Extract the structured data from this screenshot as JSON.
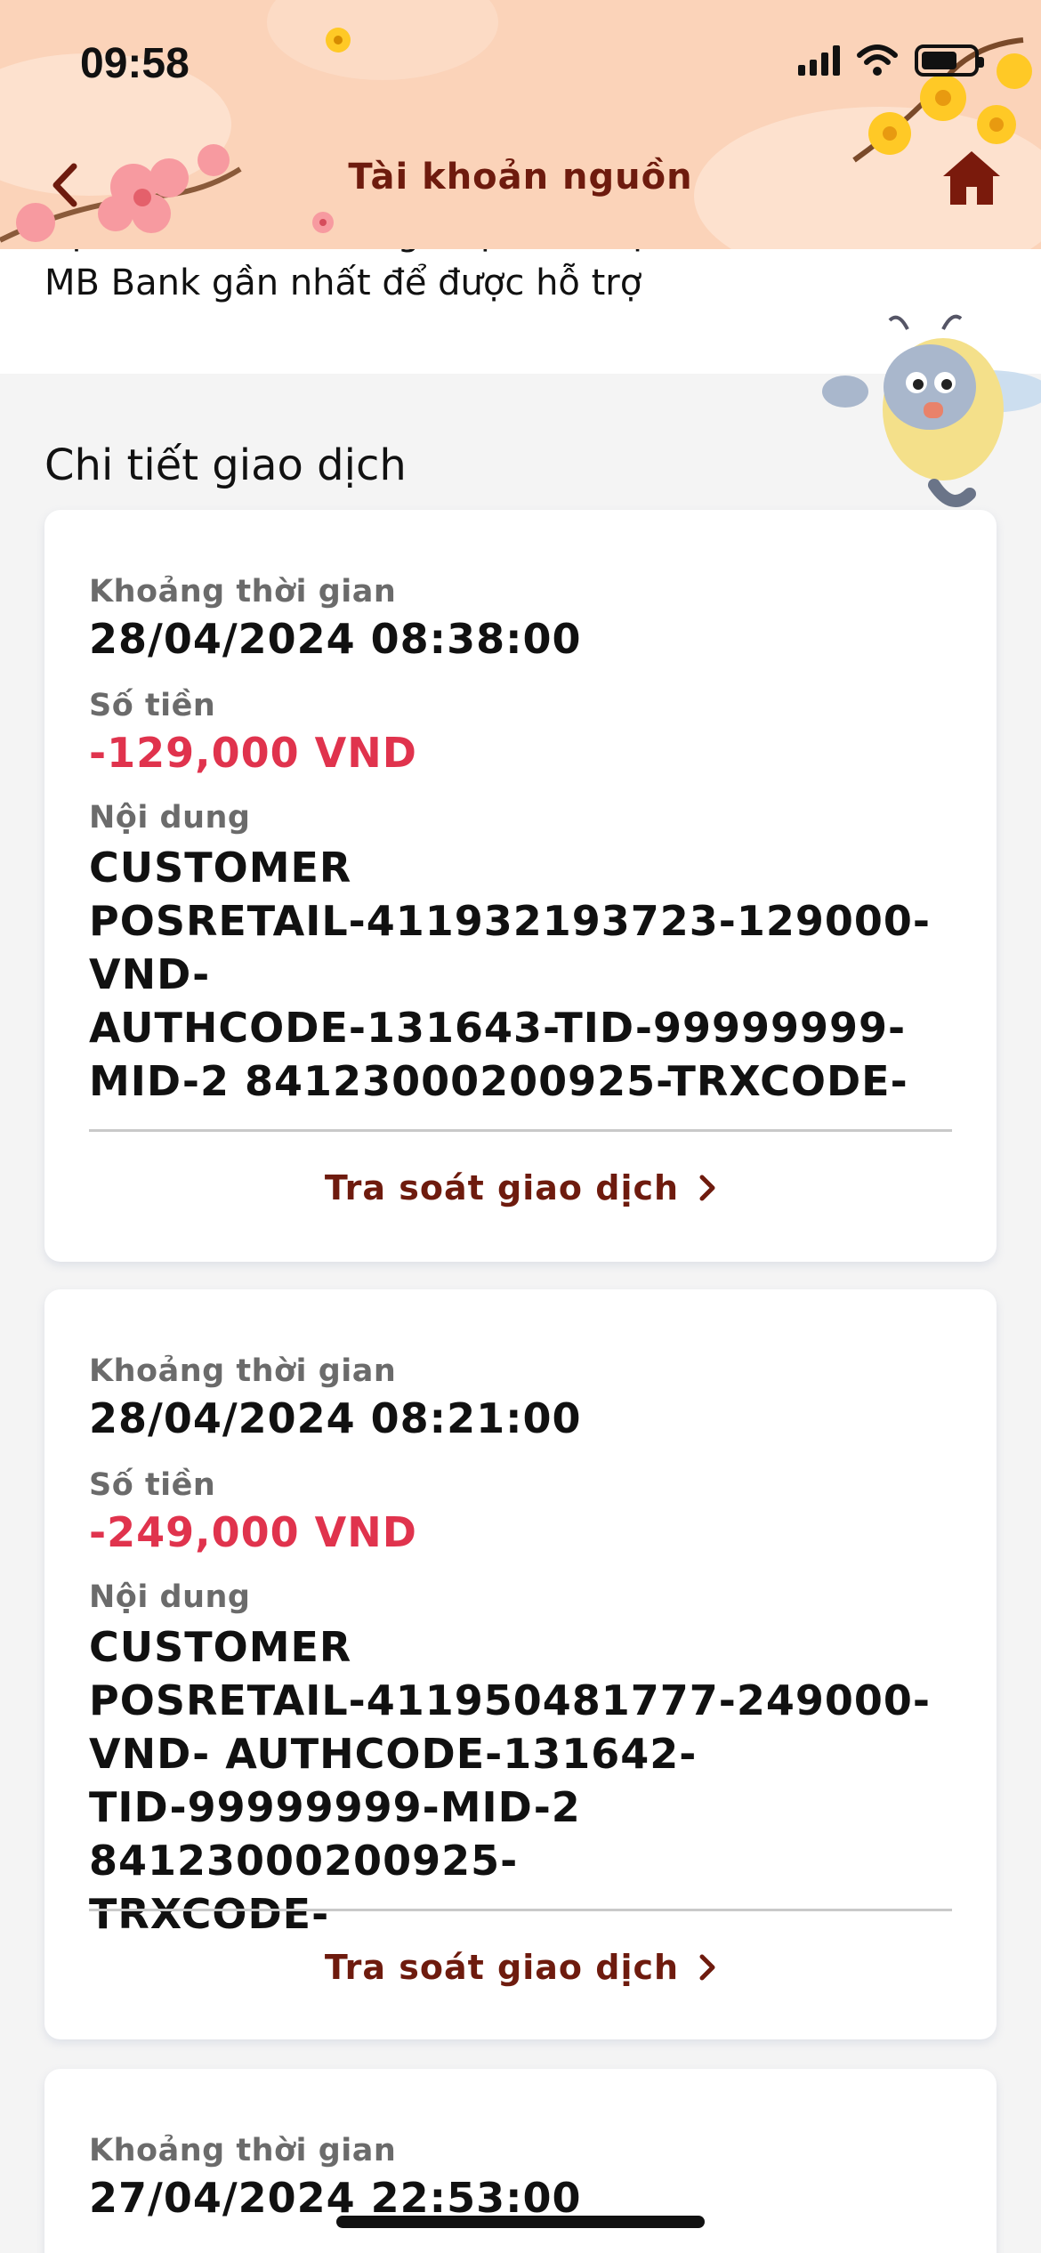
{
  "status_bar": {
    "time": "09:58"
  },
  "nav": {
    "title": "Tài khoản nguồn"
  },
  "notice": {
    "line1": "bạn Internet Banking hoặc liên hệ tới chi nhánh",
    "line2": "MB Bank gần nhất để được hỗ trợ"
  },
  "section": {
    "title": "Chi tiết giao dịch"
  },
  "labels": {
    "time": "Khoảng thời gian",
    "amount": "Số tiền",
    "content": "Nội dung",
    "inquiry": "Tra soát giao dịch"
  },
  "transactions": [
    {
      "datetime": "28/04/2024 08:38:00",
      "amount": "-129,000 VND",
      "content": [
        "CUSTOMER",
        "POSRETAIL-411932193723-129000-VND-",
        "AUTHCODE-131643-TID-99999999-",
        "MID-2 84123000200925-TRXCODE-"
      ]
    },
    {
      "datetime": "28/04/2024 08:21:00",
      "amount": "-249,000 VND",
      "content": [
        "CUSTOMER",
        "POSRETAIL-411950481777-249000-",
        "VND- AUTHCODE-131642-",
        "TID-99999999-MID-2 84123000200925-",
        "TRXCODE-"
      ]
    },
    {
      "datetime": "27/04/2024 22:53:00"
    }
  ],
  "colors": {
    "header_bg": "#fbd3b9",
    "brand_dark": "#6e1b0e",
    "amount_negative": "#e0334d",
    "page_bg": "#f4f4f4"
  },
  "icons": {
    "back": "chevron-left-icon",
    "home": "home-icon",
    "inquiry_arrow": "chevron-right-icon"
  }
}
